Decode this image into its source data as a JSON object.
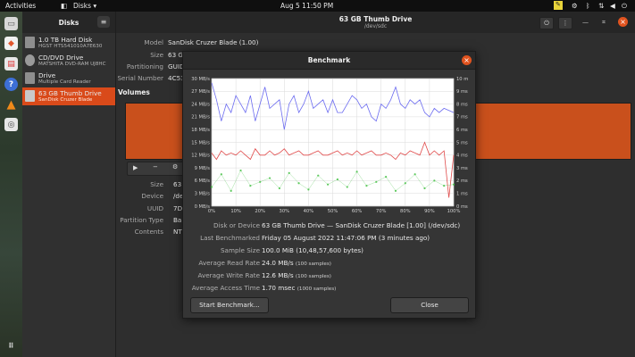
{
  "topbar": {
    "activities": "Activities",
    "app_name": "Disks",
    "app_arrow": "▾",
    "datetime": "Aug 5  11:50 PM"
  },
  "sidebar": {
    "title": "Disks",
    "items": [
      {
        "name": "1.0 TB Hard Disk",
        "sub": "HGST HTS541010A7E630"
      },
      {
        "name": "CD/DVD Drive",
        "sub": "MATSHITA DVD-RAM UJ8HC"
      },
      {
        "name": "Drive",
        "sub": "Multiple Card  Reader"
      },
      {
        "name": "63 GB Thumb Drive",
        "sub": "SanDisk Cruzer Blade"
      }
    ]
  },
  "main": {
    "title": "63 GB Thumb Drive",
    "subtitle": "/dev/sdc",
    "info": [
      {
        "label": "Model",
        "value": "SanDisk Cruzer Blade (1.00)"
      },
      {
        "label": "Size",
        "value": "63 G"
      },
      {
        "label": "Partitioning",
        "value": "GUID"
      },
      {
        "label": "Serial Number",
        "value": "4C53"
      }
    ],
    "volumes_label": "Volumes",
    "vol_info": [
      {
        "label": "Size",
        "value": "63"
      },
      {
        "label": "Device",
        "value": "/de"
      },
      {
        "label": "UUID",
        "value": "7D"
      },
      {
        "label": "Partition Type",
        "value": "Ba"
      },
      {
        "label": "Contents",
        "value": "NT"
      }
    ]
  },
  "dialog": {
    "title": "Benchmark",
    "rows": [
      {
        "label": "Disk or Device",
        "value": "63 GB Thumb Drive — SanDisk Cruzer Blade [1.00] (/dev/sdc)",
        "extra": ""
      },
      {
        "label": "Last Benchmarked",
        "value": "Friday 05 August 2022 11:47:06 PM (3 minutes ago)",
        "extra": ""
      },
      {
        "label": "Sample Size",
        "value": "100.0 MiB (10,48,57,600 bytes)",
        "extra": ""
      },
      {
        "label": "Average Read Rate",
        "value": "24.0 MB/s",
        "extra": "(100 samples)"
      },
      {
        "label": "Average Write Rate",
        "value": "12.6 MB/s",
        "extra": "(100 samples)"
      },
      {
        "label": "Average Access Time",
        "value": "1.70 msec",
        "extra": "(1000 samples)"
      }
    ],
    "start_button": "Start Benchmark...",
    "close_button": "Close"
  },
  "chart_data": {
    "type": "line",
    "x_ticks": [
      "0%",
      "10%",
      "20%",
      "30%",
      "40%",
      "50%",
      "60%",
      "70%",
      "80%",
      "90%",
      "100%"
    ],
    "y_left_ticks": [
      "0 MB/s",
      "3 MB/s",
      "6 MB/s",
      "9 MB/s",
      "12 MB/s",
      "15 MB/s",
      "18 MB/s",
      "21 MB/s",
      "24 MB/s",
      "27 MB/s",
      "30 MB/s"
    ],
    "y_right_ticks": [
      "0 ms",
      "1 ms",
      "2 ms",
      "3 ms",
      "4 ms",
      "5 ms",
      "6 ms",
      "7 ms",
      "8 ms",
      "9 ms",
      "10 ms"
    ],
    "ylim_left": [
      0,
      30
    ],
    "ylim_right": [
      0,
      10
    ],
    "grid": true,
    "colors": {
      "read": "#6b6bf0",
      "write": "#e04a4a",
      "access": "#3fbf3f"
    },
    "series": [
      {
        "key": "read",
        "x": [
          0,
          2,
          4,
          6,
          8,
          10,
          12,
          14,
          16,
          18,
          20,
          22,
          24,
          26,
          28,
          30,
          32,
          34,
          36,
          38,
          40,
          42,
          44,
          46,
          48,
          50,
          52,
          54,
          56,
          58,
          60,
          62,
          64,
          66,
          68,
          70,
          72,
          74,
          76,
          78,
          80,
          82,
          84,
          86,
          88,
          90,
          92,
          94,
          96,
          98,
          100
        ],
        "values": [
          29,
          25,
          20,
          24,
          22,
          26,
          24,
          22,
          26,
          20,
          24,
          28,
          23,
          24,
          25,
          18,
          24,
          26,
          22,
          24,
          27,
          23,
          24,
          25,
          22,
          25,
          22,
          22,
          24,
          26,
          25,
          23,
          24,
          21,
          20,
          24,
          23,
          25,
          28,
          24,
          23,
          25,
          24,
          25,
          22,
          21,
          23,
          22,
          23,
          22.5,
          22
        ]
      },
      {
        "key": "write",
        "x": [
          0,
          2,
          4,
          6,
          8,
          10,
          12,
          14,
          16,
          18,
          20,
          22,
          24,
          26,
          28,
          30,
          32,
          34,
          36,
          38,
          40,
          42,
          44,
          46,
          48,
          50,
          52,
          54,
          56,
          58,
          60,
          62,
          64,
          66,
          68,
          70,
          72,
          74,
          76,
          78,
          80,
          82,
          84,
          86,
          88,
          90,
          92,
          94,
          96,
          98,
          100
        ],
        "values": [
          12.5,
          11,
          13,
          12,
          12.5,
          12,
          13,
          12,
          11,
          13.5,
          12,
          12,
          13,
          12,
          12.5,
          13.5,
          12,
          12.5,
          13,
          12,
          12,
          12.5,
          13,
          12,
          12,
          12.5,
          13,
          12,
          12.5,
          12,
          13,
          12,
          12.5,
          13,
          12,
          12,
          12.5,
          12,
          11,
          12.5,
          12,
          13,
          12.5,
          12,
          15,
          12,
          13,
          12,
          13,
          2,
          12
        ]
      },
      {
        "key": "access",
        "x": [
          0,
          4,
          8,
          12,
          16,
          20,
          24,
          28,
          32,
          36,
          40,
          44,
          48,
          52,
          56,
          60,
          64,
          68,
          72,
          76,
          80,
          84,
          88,
          92,
          96,
          100
        ],
        "values": [
          1.5,
          2.5,
          1.2,
          2.8,
          1.6,
          1.9,
          2.2,
          1.4,
          2.6,
          1.8,
          1.3,
          2.4,
          1.7,
          2.1,
          1.5,
          2.7,
          1.6,
          1.9,
          2.3,
          1.2,
          1.8,
          2.5,
          1.4,
          2.0,
          1.6,
          1.7
        ]
      }
    ]
  }
}
